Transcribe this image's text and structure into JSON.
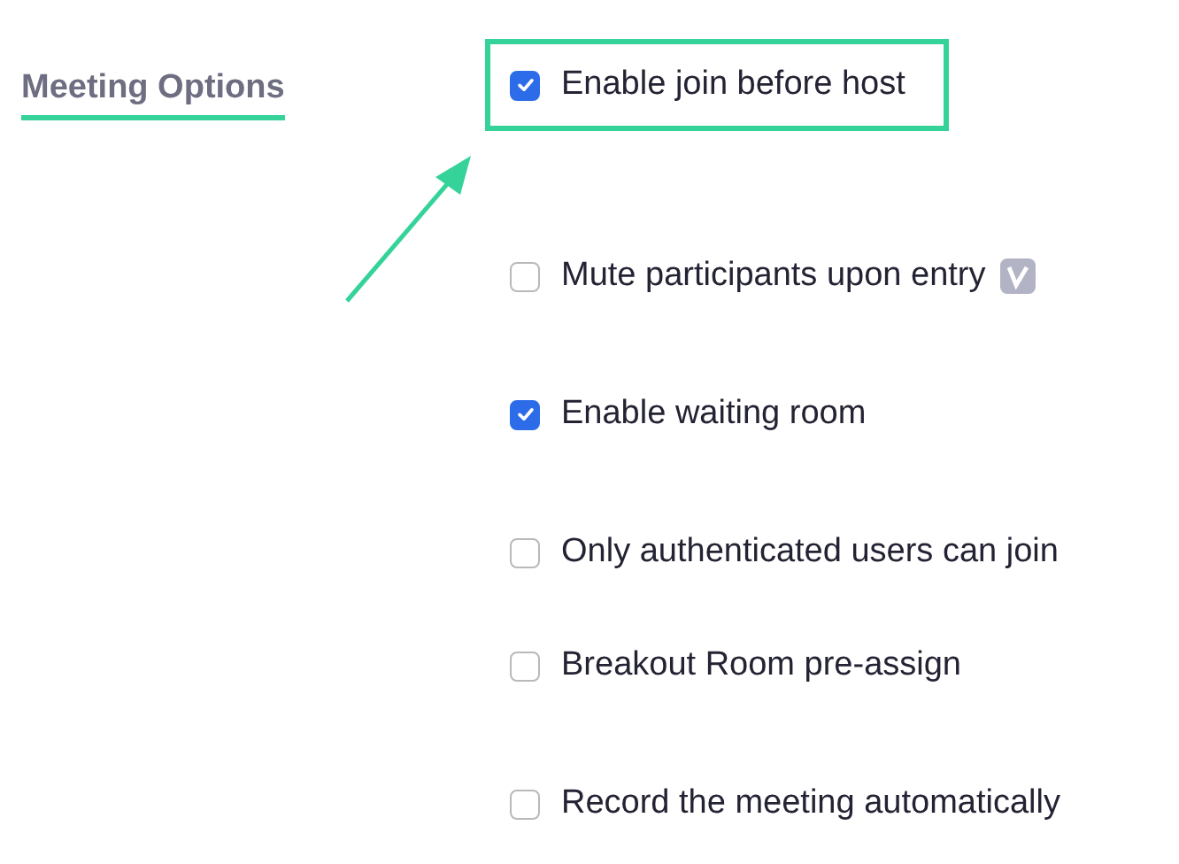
{
  "section": {
    "title": "Meeting Options"
  },
  "options": [
    {
      "label": "Enable join before host",
      "checked": true,
      "highlighted": true
    },
    {
      "label": "Mute participants upon entry",
      "checked": false,
      "highlighted": false,
      "badge": true
    },
    {
      "label": "Enable waiting room",
      "checked": true,
      "highlighted": false
    },
    {
      "label": "Only authenticated users can join",
      "checked": false,
      "highlighted": false
    },
    {
      "label": "Breakout Room pre-assign",
      "checked": false,
      "highlighted": false
    },
    {
      "label": "Record the meeting automatically",
      "checked": false,
      "highlighted": false
    }
  ]
}
